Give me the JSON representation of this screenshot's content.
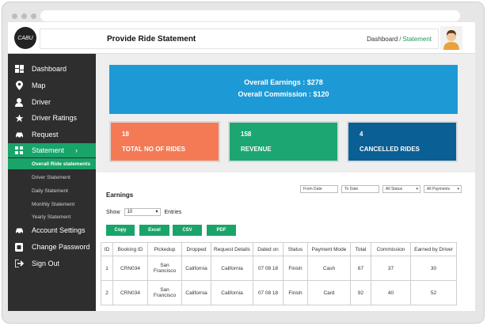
{
  "app": {
    "logo_text": "CABU",
    "page_title": "Provide Ride Statement",
    "breadcrumb": [
      "Dashboard",
      "Statement"
    ]
  },
  "sidebar": {
    "items": [
      {
        "label": "Dashboard",
        "icon": "dashboard-icon"
      },
      {
        "label": "Map",
        "icon": "map-pin-icon"
      },
      {
        "label": "Driver",
        "icon": "user-icon"
      },
      {
        "label": "Driver Ratings",
        "icon": "star-icon"
      },
      {
        "label": "Request",
        "icon": "car-icon"
      },
      {
        "label": "Statement",
        "icon": "grid-icon",
        "chevron": "›"
      },
      {
        "label": "Account Settings",
        "icon": "car-icon"
      },
      {
        "label": "Change Password",
        "icon": "lock-icon"
      },
      {
        "label": "Sign Out",
        "icon": "sign-out-icon"
      }
    ],
    "sub_items": [
      "Overall Ride statements",
      "Driver Statement",
      "Daily Statement",
      "Monthly Statement",
      "Yearly Statement"
    ]
  },
  "summary": {
    "overall_earnings": "Overall Earnings : $278",
    "overall_commission": "Overall Commission : $120"
  },
  "stats": [
    {
      "value": "18",
      "label": "TOTAL NO OF RIDES",
      "color": "#f47a55"
    },
    {
      "value": "158",
      "label": "REVENUE",
      "color": "#1ba672"
    },
    {
      "value": "4",
      "label": "CANCELLED RIDES",
      "color": "#0a5f94"
    }
  ],
  "earnings": {
    "title": "Earnings",
    "filters": {
      "from_date": "From Date",
      "to_date": "To Date",
      "status": "All Status",
      "payments": "All Payments"
    },
    "show_label": "Show",
    "entries_value": "10",
    "entries_label": "Entries",
    "buttons": [
      "Copy",
      "Excel",
      "CSV",
      "PDF"
    ],
    "columns": [
      "ID",
      "Booking ID",
      "Pickedup",
      "Dropped",
      "Request Details",
      "Dated on",
      "Status",
      "Payment Mode",
      "Total",
      "Commission",
      "Earned by Driver"
    ],
    "rows": [
      [
        "1",
        "CRN034",
        "San Francisco",
        "California",
        "California",
        "07 08 18",
        "Finish",
        "Cash",
        "67",
        "37",
        "30"
      ],
      [
        "2",
        "CRN034",
        "San Francisco",
        "California",
        "California",
        "07 08 18",
        "Finish",
        "Card",
        "92",
        "40",
        "52"
      ]
    ]
  },
  "colors": {
    "accent": "#19a46a",
    "sidebar_bg": "#2e2e2e",
    "banner_blue": "#1d9ad6"
  }
}
